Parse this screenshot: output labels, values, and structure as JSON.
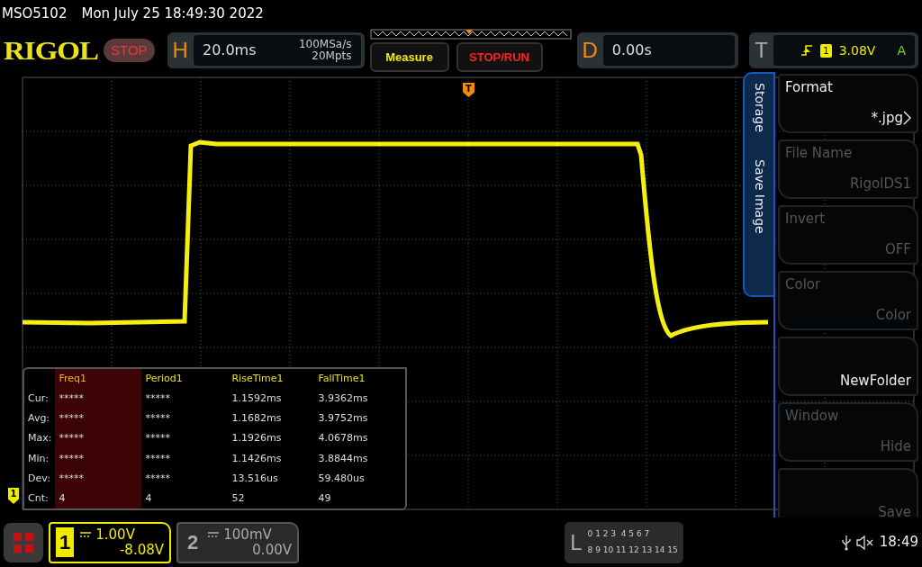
{
  "status_line": {
    "model": "MSO5102",
    "datetime": "Mon July 25 18:49:30 2022"
  },
  "header": {
    "logo": "RIGOL",
    "run_state": "STOP",
    "horizontal": {
      "letter": "H",
      "timebase": "20.0ms",
      "sample_rate": "100MSa/s",
      "memory_depth": "20Mpts"
    },
    "buttons": [
      {
        "label": "Measure",
        "kind": "measure"
      },
      {
        "label": "STOP/RUN",
        "kind": "run"
      }
    ],
    "delay": {
      "letter": "D",
      "value": "0.00s"
    },
    "trigger": {
      "letter": "T",
      "channel": "1",
      "level": "3.08V",
      "mode": "A"
    }
  },
  "screen": {
    "trigger_marker": "T",
    "channel_marker": "1"
  },
  "measurements": {
    "columns": [
      {
        "label": "Freq1",
        "selected": true
      },
      {
        "label": "Period1",
        "selected": false
      },
      {
        "label": "RiseTime1",
        "selected": false
      },
      {
        "label": "FallTime1",
        "selected": false
      }
    ],
    "rows": [
      {
        "label": "Cur:",
        "values": [
          "*****",
          "*****",
          "1.1592ms",
          "3.9362ms"
        ]
      },
      {
        "label": "Avg:",
        "values": [
          "*****",
          "*****",
          "1.1682ms",
          "3.9752ms"
        ]
      },
      {
        "label": "Max:",
        "values": [
          "*****",
          "*****",
          "1.1926ms",
          "4.0678ms"
        ]
      },
      {
        "label": "Min:",
        "values": [
          "*****",
          "*****",
          "1.1426ms",
          "3.8844ms"
        ]
      },
      {
        "label": "Dev:",
        "values": [
          "*****",
          "*****",
          "13.516us",
          "59.480us"
        ]
      },
      {
        "label": "Cnt:",
        "values": [
          "4",
          "4",
          "52",
          "49"
        ]
      }
    ]
  },
  "menu": {
    "tabs": [
      "Storage",
      "Save Image"
    ],
    "items": [
      {
        "kind": "option",
        "label": "Format",
        "value": "*.jpg",
        "disabled": false
      },
      {
        "kind": "field",
        "label": "File Name",
        "value": "RigolDS1",
        "disabled": true
      },
      {
        "kind": "field",
        "label": "Invert",
        "value": "OFF",
        "disabled": true
      },
      {
        "kind": "field",
        "label": "Color",
        "value": "Color",
        "disabled": true
      },
      {
        "kind": "action",
        "value": "NewFolder",
        "disabled": false
      },
      {
        "kind": "field",
        "label": "Window",
        "value": "Hide",
        "disabled": true
      },
      {
        "kind": "action",
        "value": "Save",
        "disabled": true
      }
    ]
  },
  "footer": {
    "channels": [
      {
        "number": "1",
        "scale": "1.00V",
        "offset": "-8.08V",
        "selected": true
      },
      {
        "number": "2",
        "scale": "100mV",
        "offset": "0.00V",
        "selected": false
      }
    ],
    "logic": {
      "letter": "L",
      "bits_low": "0 1 2 3  4 5 6 7",
      "bits_high": "8 9 10 11 12 13 14 15"
    },
    "time": "18:49"
  }
}
